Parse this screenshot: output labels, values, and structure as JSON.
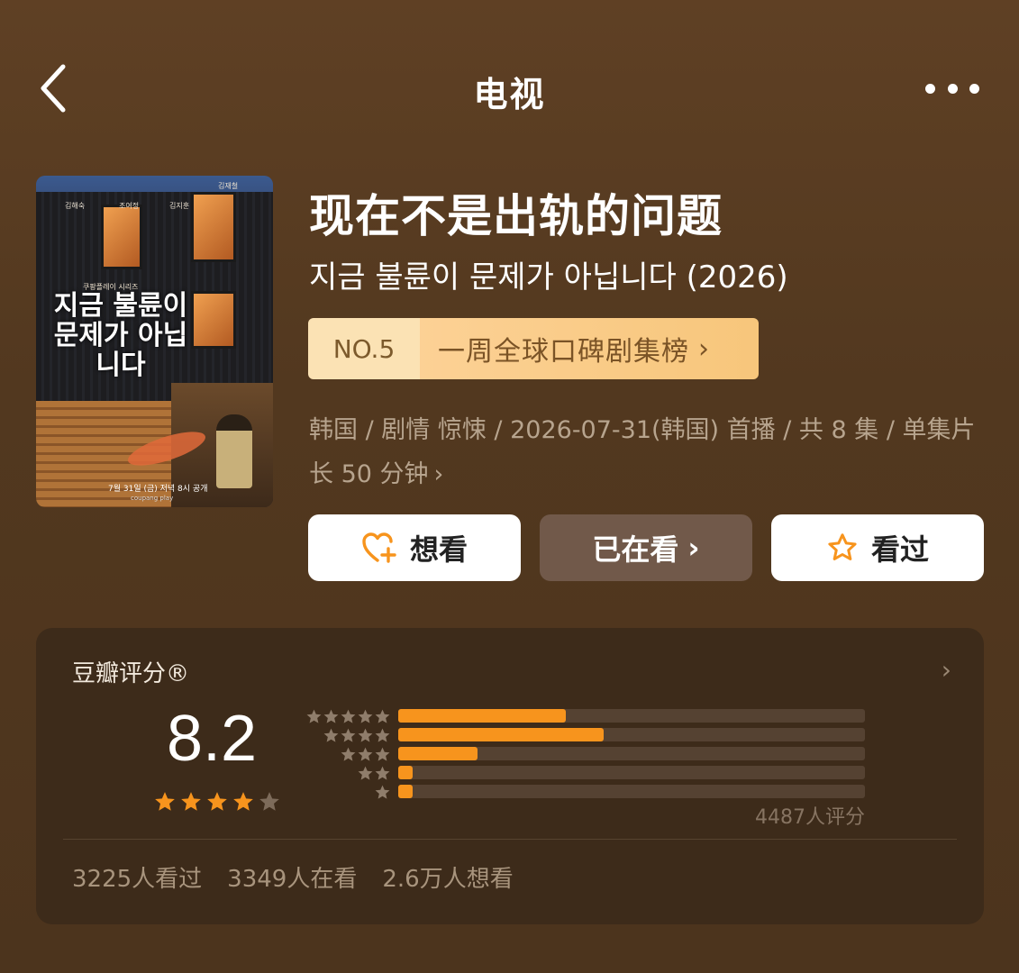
{
  "nav": {
    "title": "电视",
    "back_icon": "chevron-left-icon",
    "more_icon": "more-dots-icon"
  },
  "poster": {
    "cast": [
      "김해숙",
      "조여정",
      "김지훈",
      "김재철"
    ],
    "series_label": "쿠팡플레이 시리즈",
    "title": "지금 불륜이 문제가 아닙니다",
    "date_line": "7월 31일 (금) 저녁 8시 공개",
    "brand": "coupang play"
  },
  "title": {
    "cn": "现在不是出轨的问题",
    "original": "지금 불륜이 문제가 아닙니다 (2026)"
  },
  "rank": {
    "number": "NO.5",
    "list": "一周全球口碑剧集榜",
    "chevron": "›"
  },
  "meta": {
    "line": "韩国 / 剧情 惊悚 / 2026-07-31(韩国) 首播 / 共 8 集 / 单集片长 50 分钟",
    "chevron": "›"
  },
  "actions": {
    "want": {
      "label": "想看",
      "icon": "heart-plus-icon"
    },
    "watching": {
      "label": "已在看",
      "chevron": "›"
    },
    "watched": {
      "label": "看过",
      "icon": "star-outline-icon"
    }
  },
  "rating": {
    "title": "豆瓣评分®",
    "score": "8.2",
    "stars": 4,
    "count_text": "4487人评分",
    "distribution": [
      {
        "stars": 5,
        "fraction": 0.36
      },
      {
        "stars": 4,
        "fraction": 0.44
      },
      {
        "stars": 3,
        "fraction": 0.17
      },
      {
        "stars": 2,
        "fraction": 0.03
      },
      {
        "stars": 1,
        "fraction": 0.03
      }
    ],
    "stats": {
      "watched": "3225人看过",
      "watching": "3349人在看",
      "want": "2.6万人想看"
    }
  },
  "colors": {
    "accent": "#f7941d",
    "background": "#5a3d22",
    "card": "#3d2b1a",
    "rank_bg": "#fcd195"
  }
}
